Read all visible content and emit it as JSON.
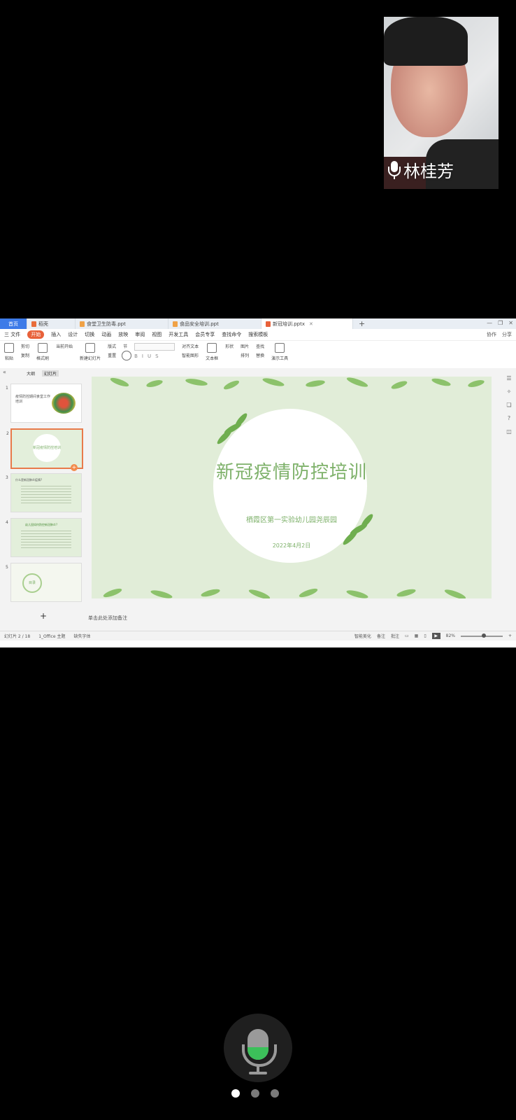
{
  "participant": {
    "name": "林桂芳"
  },
  "tabs": [
    {
      "label": "首页"
    },
    {
      "label": "稻壳"
    },
    {
      "label": "食堂卫生防毒.ppt"
    },
    {
      "label": "食品安全培训.ppt"
    },
    {
      "label": "新冠培训.pptx"
    }
  ],
  "menu": [
    "三 文件",
    "开始",
    "插入",
    "设计",
    "切换",
    "动画",
    "放映",
    "审阅",
    "视图",
    "开发工具",
    "会员专享",
    "查找命令",
    "搜索模板"
  ],
  "menu_right": [
    "协作",
    "分享"
  ],
  "ribbon": {
    "paste": "粘贴",
    "cut": "剪切",
    "copy": "复制",
    "format_painter": "格式刷",
    "from_start": "当前开始",
    "new_slide": "新建幻灯片",
    "layout": "版式",
    "reset": "重置",
    "section": "节",
    "textbox": "文本框",
    "shape": "形状",
    "picture": "图片",
    "arrange": "排列",
    "find": "查找",
    "replace": "替换",
    "presenter": "演示工具",
    "align_text": "对齐文本",
    "smart_graphic": "智能图形"
  },
  "pane_tabs": [
    "大纲",
    "幻灯片"
  ],
  "thumbnails": [
    {
      "num": "1",
      "title": "疫情防控期间食堂工作培训"
    },
    {
      "num": "2",
      "title": "新冠疫情防控培训"
    },
    {
      "num": "3",
      "title": "什么是新冠肺炎疫情?"
    },
    {
      "num": "4",
      "title": "幼儿园如何防控新冠肺炎?"
    },
    {
      "num": "5",
      "title": "目录"
    }
  ],
  "slide": {
    "title": "新冠疫情防控培训",
    "subtitle": "栖霞区第一实验幼儿园尧辰园",
    "date": "2022年4月2日"
  },
  "notes_placeholder": "单击此处添加备注",
  "status": {
    "slide_count": "幻灯片 2 / 18",
    "theme": "1_Office 主题",
    "missing_font": "缺失字体",
    "smart_beautify": "智能美化",
    "notes": "备注",
    "comment": "批注",
    "zoom": "82%"
  },
  "colors": {
    "accent": "#e8613a",
    "slide_green": "#7eb16a",
    "mic_active": "#3cc05a"
  }
}
